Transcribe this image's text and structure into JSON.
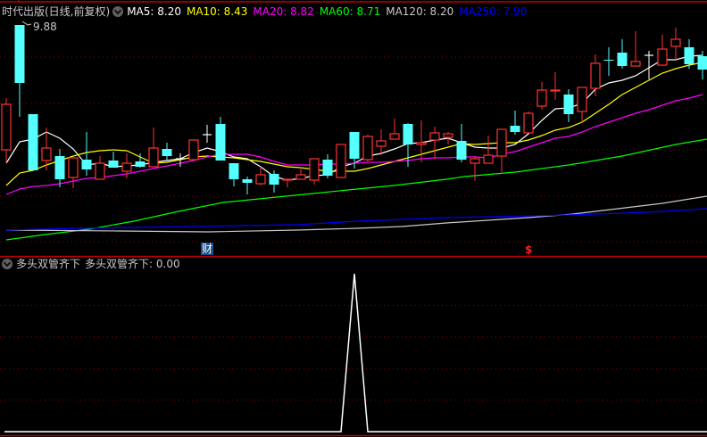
{
  "header": {
    "title": "时代出版(日线,前复权)",
    "ma_labels": [
      {
        "text": "MA5: 8.20",
        "color": "#ffffff"
      },
      {
        "text": "MA10: 8.43",
        "color": "#ffff00"
      },
      {
        "text": "MA20: 8.82",
        "color": "#ff00ff"
      },
      {
        "text": "MA60: 8.71",
        "color": "#00ff00"
      },
      {
        "text": "MA120: 8.20",
        "color": "#c8c8c8"
      },
      {
        "text": "MA250: 7.90",
        "color": "#0000ff"
      }
    ]
  },
  "indicator": {
    "name": "多头双管齐下",
    "value_label": "多头双管齐下: 0.00"
  },
  "markers": {
    "cai": {
      "text": "财",
      "index": 15
    },
    "dollar": {
      "text": "$",
      "index": 39
    }
  },
  "colors": {
    "up": "#ff3232",
    "down": "#54ffff",
    "doji": "#ffffff",
    "grid": "#8b0000",
    "border": "#c00000"
  },
  "chart_data": [
    {
      "type": "candlestick",
      "title": "时代出版(日线,前复权)",
      "price_range": [
        7.45,
        10.16
      ],
      "gridlines": [
        9.52,
        9.0,
        8.48,
        7.96
      ],
      "max_label": {
        "text": "9.88",
        "index": 1,
        "value": 9.88
      },
      "candles": [
        [
          8.48,
          8.99,
          9.06,
          8.33
        ],
        [
          9.88,
          9.23,
          9.88,
          8.85
        ],
        [
          8.88,
          8.25,
          8.88,
          8.25
        ],
        [
          8.36,
          8.5,
          8.73,
          8.25
        ],
        [
          8.41,
          8.15,
          8.49,
          8.06
        ],
        [
          8.17,
          8.39,
          8.39,
          8.05
        ],
        [
          8.37,
          8.26,
          8.68,
          8.19
        ],
        [
          8.15,
          8.33,
          8.41,
          8.15
        ],
        [
          8.36,
          8.28,
          8.46,
          8.28
        ],
        [
          8.24,
          8.33,
          8.44,
          8.16
        ],
        [
          8.35,
          8.29,
          8.44,
          8.28
        ],
        [
          8.29,
          8.5,
          8.73,
          8.29
        ],
        [
          8.49,
          8.41,
          8.56,
          8.36
        ],
        [
          8.38,
          8.38,
          8.44,
          8.29
        ],
        [
          8.37,
          8.59,
          8.59,
          8.37
        ],
        [
          8.65,
          8.65,
          8.76,
          8.56
        ],
        [
          8.77,
          8.36,
          8.85,
          8.36
        ],
        [
          8.33,
          8.15,
          8.33,
          8.07
        ],
        [
          8.15,
          8.11,
          8.18,
          7.98
        ],
        [
          8.1,
          8.2,
          8.29,
          8.08
        ],
        [
          8.21,
          8.09,
          8.25,
          8.0
        ],
        [
          8.14,
          8.15,
          8.15,
          8.06
        ],
        [
          8.15,
          8.2,
          8.29,
          8.15
        ],
        [
          8.14,
          8.38,
          8.38,
          8.09
        ],
        [
          8.37,
          8.19,
          8.43,
          8.16
        ],
        [
          8.17,
          8.54,
          8.54,
          8.17
        ],
        [
          8.68,
          8.38,
          8.68,
          8.27
        ],
        [
          8.37,
          8.63,
          8.65,
          8.35
        ],
        [
          8.52,
          8.58,
          8.71,
          8.42
        ],
        [
          8.6,
          8.66,
          8.83,
          8.6
        ],
        [
          8.77,
          8.54,
          8.78,
          8.29
        ],
        [
          8.54,
          8.56,
          8.81,
          8.34
        ],
        [
          8.59,
          8.67,
          8.74,
          8.38
        ],
        [
          8.62,
          8.66,
          8.68,
          8.54
        ],
        [
          8.58,
          8.37,
          8.77,
          8.34
        ],
        [
          8.33,
          8.38,
          8.41,
          8.13
        ],
        [
          8.33,
          8.42,
          8.64,
          8.33
        ],
        [
          8.41,
          8.71,
          8.71,
          8.23
        ],
        [
          8.75,
          8.68,
          8.92,
          8.65
        ],
        [
          8.67,
          8.89,
          8.91,
          8.67
        ],
        [
          8.97,
          9.15,
          9.24,
          8.93
        ],
        [
          9.14,
          9.15,
          9.35,
          9.04
        ],
        [
          9.1,
          8.88,
          9.16,
          8.79
        ],
        [
          8.91,
          9.18,
          9.18,
          8.79
        ],
        [
          9.17,
          9.45,
          9.55,
          9.08
        ],
        [
          9.49,
          9.48,
          9.63,
          9.31
        ],
        [
          9.57,
          9.42,
          9.72,
          9.39
        ],
        [
          9.42,
          9.47,
          9.81,
          9.42
        ],
        [
          9.54,
          9.54,
          9.59,
          9.27
        ],
        [
          9.43,
          9.61,
          9.77,
          9.43
        ],
        [
          9.64,
          9.72,
          9.85,
          9.49
        ],
        [
          9.63,
          9.44,
          9.72,
          9.39
        ],
        [
          9.53,
          9.38,
          9.59,
          9.27
        ]
      ],
      "ma_series": [
        {
          "name": "MA5",
          "color": "#ffffff",
          "values": [
            8.33,
            8.57,
            8.6,
            8.68,
            8.61,
            8.49,
            8.31,
            8.33,
            8.29,
            8.3,
            8.31,
            8.34,
            8.36,
            8.38,
            8.45,
            8.5,
            8.46,
            8.4,
            8.38,
            8.29,
            8.18,
            8.14,
            8.16,
            8.19,
            8.2,
            8.29,
            8.33,
            8.41,
            8.44,
            8.49,
            8.55,
            8.56,
            8.59,
            8.61,
            8.56,
            8.51,
            8.5,
            8.5,
            8.54,
            8.66,
            8.81,
            8.94,
            8.95,
            9.0,
            9.16,
            9.23,
            9.26,
            9.31,
            9.4,
            9.49,
            9.49,
            9.53,
            9.54
          ]
        },
        {
          "name": "MA10",
          "color": "#ffff00",
          "values": [
            8.08,
            8.22,
            8.25,
            8.31,
            8.36,
            8.41,
            8.45,
            8.47,
            8.48,
            8.47,
            8.4,
            8.33,
            8.34,
            8.37,
            8.4,
            8.41,
            8.4,
            8.39,
            8.37,
            8.35,
            8.32,
            8.29,
            8.28,
            8.26,
            8.24,
            8.24,
            8.24,
            8.27,
            8.31,
            8.35,
            8.39,
            8.43,
            8.47,
            8.51,
            8.55,
            8.54,
            8.55,
            8.56,
            8.56,
            8.59,
            8.64,
            8.7,
            8.73,
            8.79,
            8.89,
            8.99,
            9.1,
            9.18,
            9.26,
            9.34,
            9.39,
            9.43,
            9.46
          ]
        },
        {
          "name": "MA20",
          "color": "#ff00ff",
          "values": [
            7.98,
            8.04,
            8.07,
            8.08,
            8.1,
            8.13,
            8.16,
            8.17,
            8.19,
            8.21,
            8.24,
            8.27,
            8.3,
            8.33,
            8.36,
            8.4,
            8.43,
            8.43,
            8.43,
            8.4,
            8.35,
            8.31,
            8.31,
            8.31,
            8.32,
            8.32,
            8.33,
            8.34,
            8.34,
            8.35,
            8.36,
            8.38,
            8.39,
            8.39,
            8.4,
            8.4,
            8.39,
            8.43,
            8.46,
            8.51,
            8.56,
            8.61,
            8.63,
            8.68,
            8.74,
            8.79,
            8.84,
            8.89,
            8.93,
            8.98,
            9.03,
            9.06,
            9.1
          ]
        },
        {
          "name": "MA60",
          "color": "#00ff00",
          "points": [
            [
              0,
              7.47
            ],
            [
              2.87,
              7.53
            ],
            [
              6.2,
              7.59
            ],
            [
              9.53,
              7.68
            ],
            [
              12.87,
              7.79
            ],
            [
              16.2,
              7.89
            ],
            [
              19.53,
              7.94
            ],
            [
              22.87,
              7.99
            ],
            [
              26.2,
              8.04
            ],
            [
              28.93,
              8.08
            ],
            [
              32.87,
              8.15
            ],
            [
              34.2,
              8.18
            ],
            [
              38,
              8.23
            ],
            [
              42,
              8.31
            ],
            [
              46,
              8.41
            ],
            [
              50,
              8.54
            ],
            [
              52.33,
              8.6
            ]
          ]
        },
        {
          "name": "MA120",
          "color": "#c8c8c8",
          "points": [
            [
              0,
              7.58
            ],
            [
              8.4,
              7.57
            ],
            [
              15.07,
              7.56
            ],
            [
              21.73,
              7.58
            ],
            [
              26.2,
              7.6
            ],
            [
              29.53,
              7.62
            ],
            [
              32.87,
              7.66
            ],
            [
              39,
              7.72
            ],
            [
              42.33,
              7.76
            ],
            [
              45.67,
              7.82
            ],
            [
              49,
              7.88
            ],
            [
              52.33,
              7.96
            ]
          ]
        },
        {
          "name": "MA250",
          "color": "#0000ff",
          "points": [
            [
              0,
              7.58
            ],
            [
              2.4,
              7.59
            ],
            [
              5.53,
              7.6
            ],
            [
              9.53,
              7.61
            ],
            [
              17.33,
              7.63
            ],
            [
              21.73,
              7.64
            ],
            [
              26.2,
              7.68
            ],
            [
              29.53,
              7.7
            ],
            [
              32.87,
              7.72
            ],
            [
              39.53,
              7.74
            ],
            [
              46.2,
              7.77
            ],
            [
              49,
              7.79
            ],
            [
              52.33,
              7.82
            ]
          ]
        }
      ]
    },
    {
      "type": "line",
      "title": "多头双管齐下",
      "ylim": [
        0,
        1
      ],
      "gridlines": [
        0.2,
        0.4,
        0.6,
        0.8
      ],
      "values": [
        0,
        0,
        0,
        0,
        0,
        0,
        0,
        0,
        0,
        0,
        0,
        0,
        0,
        0,
        0,
        0,
        0,
        0,
        0,
        0,
        0,
        0,
        0,
        0,
        0,
        0,
        1,
        0,
        0,
        0,
        0,
        0,
        0,
        0,
        0,
        0,
        0,
        0,
        0,
        0,
        0,
        0,
        0,
        0,
        0,
        0,
        0,
        0,
        0,
        0,
        0,
        0,
        0
      ]
    }
  ]
}
